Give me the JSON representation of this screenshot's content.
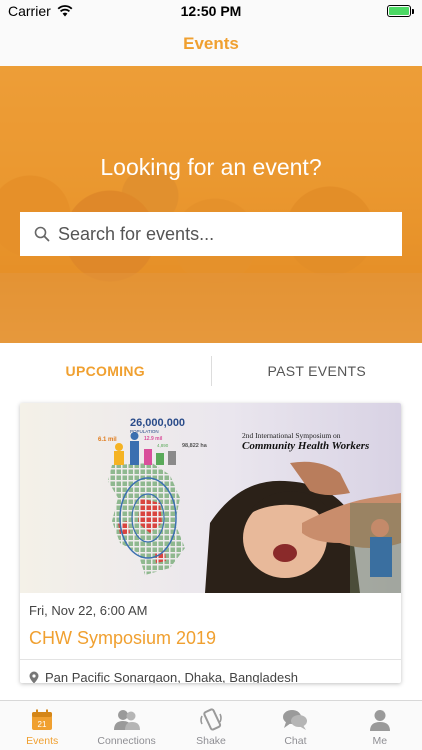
{
  "status_bar": {
    "carrier": "Carrier",
    "time": "12:50 PM"
  },
  "nav": {
    "title": "Events"
  },
  "hero": {
    "heading": "Looking for an event?",
    "search_placeholder": "Search for events..."
  },
  "tabs": [
    {
      "label": "UPCOMING",
      "active": true
    },
    {
      "label": "PAST EVENTS",
      "active": false
    }
  ],
  "events": [
    {
      "date": "Fri, Nov 22, 6:00 AM",
      "title": "CHW Symposium 2019",
      "location": "Pan Pacific Sonargaon, Dhaka, Bangladesh",
      "image": {
        "population": "26,000,000",
        "population_label": "POPULATION",
        "stat_left": "6.1 mil",
        "stat_mid": "12.9 mil",
        "stat_mid2": "4,890",
        "stat_right": "98,822 ha",
        "headline_line1": "2nd International Symposium on",
        "headline_line2": "Community Health Workers"
      }
    }
  ],
  "tab_bar": {
    "calendar_day": "21",
    "items": [
      {
        "label": "Events",
        "icon": "calendar-icon",
        "active": true
      },
      {
        "label": "Connections",
        "icon": "connections-icon",
        "active": false
      },
      {
        "label": "Shake",
        "icon": "shake-phone-icon",
        "active": false
      },
      {
        "label": "Chat",
        "icon": "chat-bubbles-icon",
        "active": false
      },
      {
        "label": "Me",
        "icon": "person-icon",
        "active": false
      }
    ]
  },
  "colors": {
    "accent": "#f0a030",
    "battery": "#4cd964"
  }
}
